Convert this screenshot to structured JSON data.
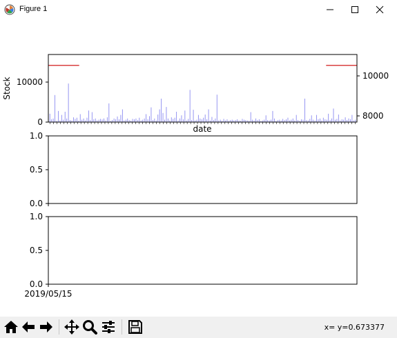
{
  "window": {
    "title": "Figure 1",
    "icon": "matplotlib-logo-icon",
    "buttons": [
      "minimize-icon",
      "maximize-icon",
      "close-icon"
    ]
  },
  "toolbar": {
    "tools": [
      "home-icon",
      "back-arrow-icon",
      "forward-arrow-icon",
      "pan-icon",
      "zoom-icon",
      "configure-subplots-icon",
      "save-icon"
    ],
    "status": "x= y=0.673377"
  },
  "chart_data": [
    {
      "type": "bar",
      "xlabel": "date",
      "ylabel": "Stock",
      "ylim": [
        0,
        17000
      ],
      "yticks": [
        0,
        10000
      ],
      "bar_color": "#8a8af0",
      "values": [
        2100,
        700,
        900,
        6800,
        300,
        2800,
        400,
        1800,
        600,
        2600,
        900,
        9700,
        500,
        400,
        1200,
        800,
        1100,
        350,
        2000,
        600,
        900,
        400,
        1100,
        2900,
        500,
        2500,
        700,
        900,
        400,
        600,
        800,
        650,
        900,
        400,
        1200,
        4700,
        300,
        500,
        900,
        700,
        1400,
        700,
        1800,
        3200,
        400,
        600,
        900,
        500,
        350,
        800,
        700,
        900,
        500,
        1100,
        400,
        600,
        900,
        2000,
        700,
        1500,
        3700,
        500,
        900,
        400,
        1900,
        3200,
        5900,
        2300,
        600,
        3800,
        900,
        400,
        1200,
        800,
        1100,
        2600,
        400,
        900,
        1700,
        700,
        2900,
        400,
        800,
        8100,
        500,
        3100,
        400,
        600,
        1800,
        900,
        700,
        1100,
        1900,
        700,
        3200,
        400,
        1300,
        500,
        900,
        6900,
        400,
        600,
        300,
        800,
        400,
        700,
        300,
        500,
        600,
        400,
        500,
        700,
        400,
        300,
        800,
        600,
        500,
        400,
        300,
        2500,
        600,
        400,
        900,
        500,
        700,
        300,
        400,
        600,
        1700,
        500,
        400,
        600,
        2800,
        900,
        300,
        500,
        600,
        400,
        800,
        500,
        700,
        1100,
        400,
        600,
        900,
        400,
        1800,
        500,
        300,
        700,
        600,
        5900,
        500,
        400,
        800,
        1700,
        600,
        400,
        1800,
        700,
        900,
        400,
        1100,
        700,
        600,
        2100,
        500,
        900,
        3400,
        600,
        800,
        1900,
        400,
        700,
        600,
        1200,
        500,
        900,
        700,
        1800,
        400,
        600
      ]
    },
    {
      "type": "line",
      "secondary_axis": true,
      "ylim": [
        7700,
        10800
      ],
      "yticks": [
        8000,
        10000
      ],
      "color": "#cc0000",
      "segments": [
        {
          "x_frac": [
            0.0,
            0.1
          ],
          "y": 10300
        },
        {
          "x_frac": [
            0.9,
            1.0
          ],
          "y": 10300
        }
      ]
    },
    {
      "type": "line",
      "ylim": [
        0.0,
        1.0
      ],
      "yticks": [
        "0.0",
        "0.5",
        "1.0"
      ],
      "series": []
    },
    {
      "type": "line",
      "ylim": [
        0.0,
        1.0
      ],
      "yticks": [
        "0.0",
        "0.5",
        "1.0"
      ],
      "xticks": [
        "2019/05/15"
      ],
      "series": []
    }
  ]
}
